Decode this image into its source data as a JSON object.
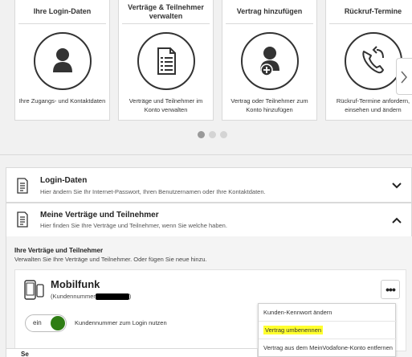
{
  "carousel": {
    "cards": [
      {
        "title": "Ihre Login-Daten",
        "description": "Ihre Zugangs- und Kontaktdaten",
        "icon": "user-icon"
      },
      {
        "title": "Verträge & Teilnehmer verwalten",
        "description": "Verträge und Teilnehmer im Konto verwalten",
        "icon": "document-list-icon"
      },
      {
        "title": "Vertrag hinzufügen",
        "description": "Vertrag oder Teilnehmer zum Konto hinzufügen",
        "icon": "user-add-icon"
      },
      {
        "title": "Rückruf-Termine",
        "description": "Rückruf-Termine anfordern, einsehen und ändern",
        "icon": "phone-callback-icon"
      }
    ],
    "next_icon": "chevron-right-icon",
    "active_dot": 1,
    "dot_count": 3
  },
  "sections": {
    "login": {
      "title": "Login-Daten",
      "subtitle": "Hier ändern Sie Ihr Internet-Passwort, Ihren Benutzernamen oder Ihre Kontaktdaten.",
      "icon": "document-icon",
      "chevron": "chevron-down-icon"
    },
    "vertraege": {
      "title": "Meine Verträge und Teilnehmer",
      "subtitle": "Hier finden Sie Ihre Verträge und Teilnehmer, wenn Sie welche haben.",
      "icon": "document-icon",
      "chevron": "chevron-up-icon"
    }
  },
  "vertraege_panel": {
    "title": "Ihre Verträge und Teilnehmer",
    "subtitle": "Verwalten Sie Ihre Verträge und Teilnehmer. Oder fügen Sie neue hinzu.",
    "contract": {
      "title": "Mobilfunk",
      "kundennummer_label": "(Kundennummer",
      "kundennummer_suffix": ")",
      "more_label": "•••",
      "toggle_label": "ein",
      "toggle_on": true,
      "toggle_text": "Kundennummer zum Login nutzen"
    }
  },
  "menu": {
    "items": [
      {
        "label": "Kunden-Kennwort ändern"
      },
      {
        "label": "Vertrag umbenennen",
        "highlighted": true
      },
      {
        "label": "Vertrag aus dem MeinVodafone-Konto entfernen"
      }
    ]
  },
  "bottom_section": {
    "title": "Se"
  },
  "colors": {
    "toggle_on": "#2e7d14",
    "highlight": "#ffff2e"
  }
}
